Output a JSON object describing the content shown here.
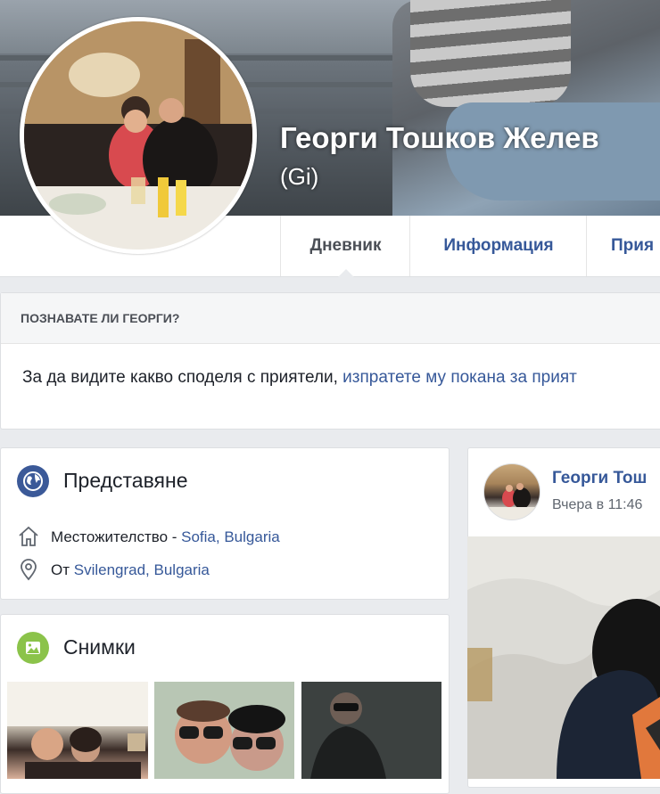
{
  "profile": {
    "name": "Георги Тошков Желев",
    "alternate_name": "(Gi)"
  },
  "tabs": [
    {
      "label": "Дневник",
      "active": true
    },
    {
      "label": "Информация",
      "active": false
    },
    {
      "label": "Прия",
      "active": false
    }
  ],
  "know": {
    "title": "ПОЗНАВАТЕ ЛИ ГЕОРГИ?",
    "text": "За да видите какво споделя с приятели, ",
    "link": "изпратете му покана за прият"
  },
  "intro": {
    "title": "Представяне",
    "residence_label": "Местожителство - ",
    "residence_value": "Sofia, Bulgaria",
    "from_label": "От ",
    "from_value": "Svilengrad, Bulgaria"
  },
  "photos": {
    "title": "Снимки"
  },
  "post": {
    "author": "Георги Тош",
    "time": "Вчера в 11:46"
  },
  "colors": {
    "link": "#365899",
    "intro_icon": "#3b5998",
    "photos_icon": "#8bc34a",
    "background": "#e9ebee"
  },
  "icons": {
    "intro": "globe-icon",
    "residence": "home-icon",
    "from": "location-pin-icon",
    "photos": "photo-icon"
  }
}
